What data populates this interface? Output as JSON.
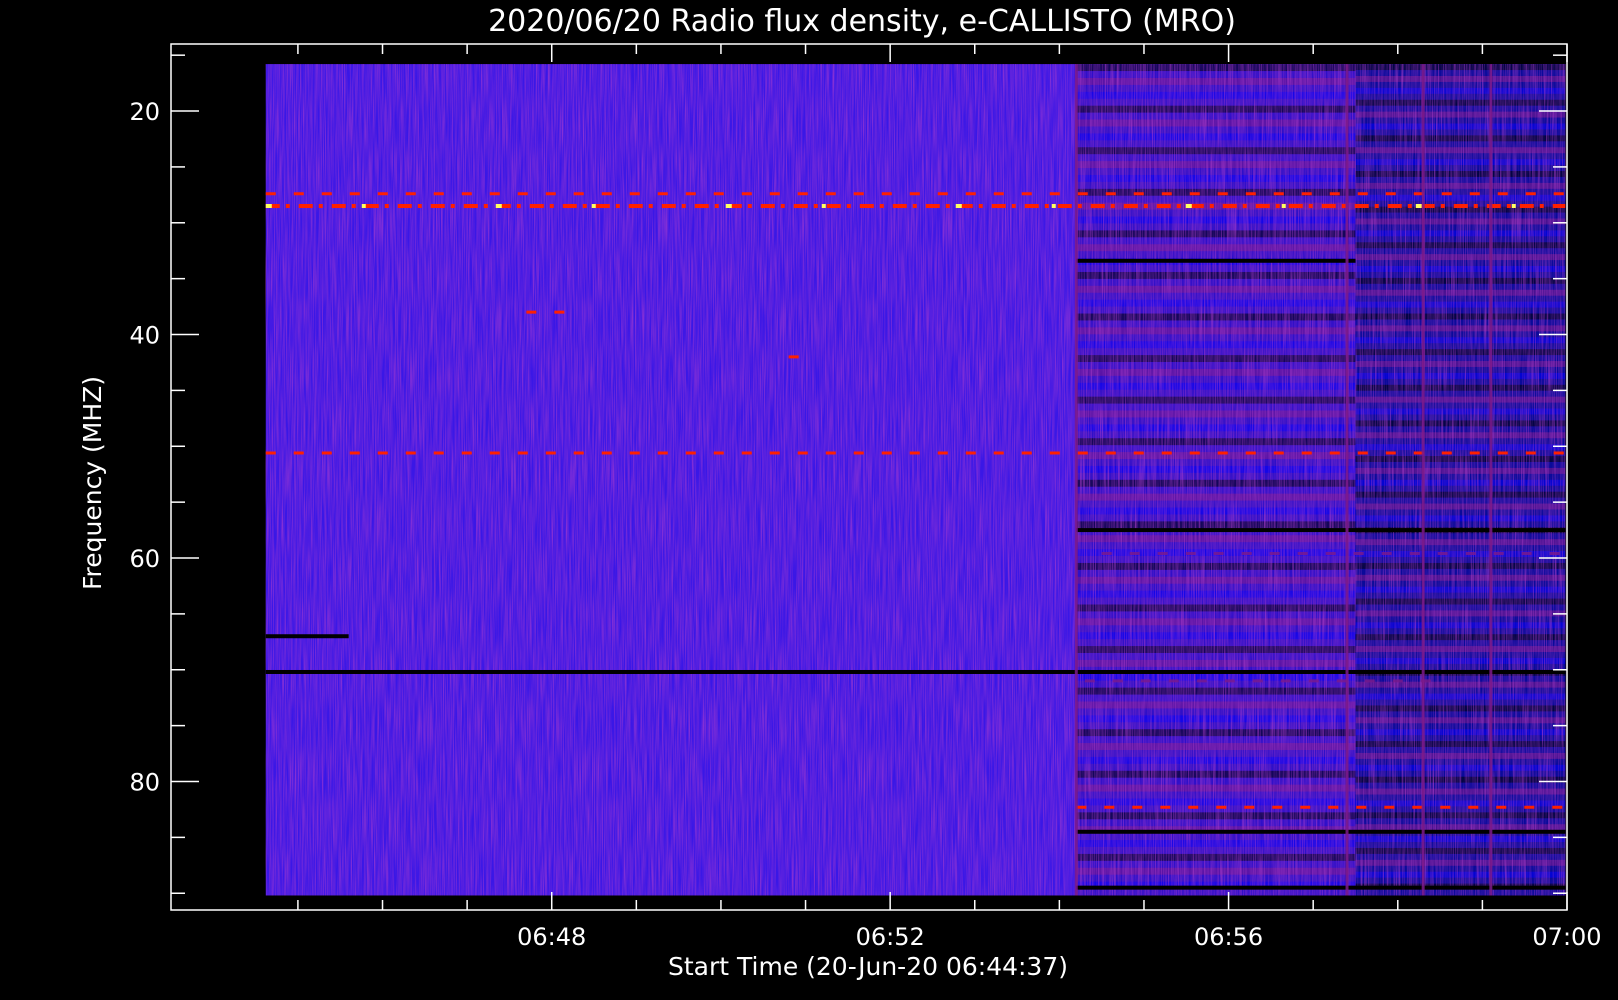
{
  "chart_data": {
    "type": "heatmap",
    "title": "2020/06/20  Radio flux density, e-CALLISTO (MRO)",
    "xlabel": "Start Time (20-Jun-20 06:44:37)",
    "ylabel": "Frequency (MHZ)",
    "x_start_min": 44.62,
    "x_range_min": [
      43.5,
      60.0
    ],
    "x_ticks": [
      {
        "label": "06:48",
        "minute": 48
      },
      {
        "label": "06:52",
        "minute": 52
      },
      {
        "label": "06:56",
        "minute": 56
      },
      {
        "label": "07:00",
        "minute": 60
      }
    ],
    "x_minor_minutes": [
      45,
      46,
      47,
      49,
      50,
      51,
      53,
      54,
      55,
      57,
      58,
      59
    ],
    "y_range_mhz": [
      14,
      91.5
    ],
    "y_ticks": [
      {
        "label": "20",
        "value": 20
      },
      {
        "label": "40",
        "value": 40
      },
      {
        "label": "60",
        "value": 60
      },
      {
        "label": "80",
        "value": 80
      }
    ],
    "y_minor_mhz": [
      15,
      25,
      30,
      35,
      45,
      50,
      55,
      65,
      70,
      75,
      85,
      90
    ],
    "data_extent": {
      "x_min": [
        44.62,
        59.98
      ],
      "y_mhz": [
        15.8,
        90.2
      ]
    },
    "colormap": [
      "#000000",
      "#0000ff",
      "#7d1a8a",
      "#ff2000",
      "#ffff60"
    ],
    "base_color": "#3a17e6",
    "bright_bands": [
      {
        "freq": 28.5,
        "x": [
          44.62,
          59.98
        ],
        "level": "high"
      },
      {
        "freq": 27.4,
        "x": [
          44.62,
          59.98
        ],
        "level": "mid"
      },
      {
        "freq": 50.6,
        "x": [
          44.62,
          59.98
        ],
        "level": "mid"
      },
      {
        "freq": 82.3,
        "x": [
          54.2,
          59.98
        ],
        "level": "mid"
      },
      {
        "freq": 59.6,
        "x": [
          54.5,
          59.98
        ],
        "level": "low"
      },
      {
        "freq": 71.0,
        "x": [
          54.3,
          58.5
        ],
        "level": "low"
      },
      {
        "freq": 38.0,
        "x": [
          47.7,
          48.2
        ],
        "level": "mid"
      },
      {
        "freq": 42.0,
        "x": [
          50.8,
          51.1
        ],
        "level": "mid"
      }
    ],
    "dark_bands": [
      {
        "freq": 67.0,
        "x": [
          44.62,
          45.6
        ]
      },
      {
        "freq": 70.2,
        "x": [
          44.62,
          59.98
        ]
      },
      {
        "freq": 33.4,
        "x": [
          54.2,
          57.5
        ]
      },
      {
        "freq": 84.5,
        "x": [
          54.2,
          59.98
        ]
      },
      {
        "freq": 89.5,
        "x": [
          54.2,
          59.98
        ]
      },
      {
        "freq": 57.5,
        "x": [
          54.2,
          59.98
        ]
      }
    ],
    "regions": [
      {
        "x": [
          54.2,
          57.5
        ],
        "y": [
          15.8,
          90.2
        ],
        "style": "banded"
      },
      {
        "x": [
          57.5,
          59.98
        ],
        "y": [
          15.8,
          90.2
        ],
        "style": "dark-banded"
      }
    ],
    "vertical_lines": [
      54.2,
      57.4,
      58.3,
      59.1
    ]
  }
}
